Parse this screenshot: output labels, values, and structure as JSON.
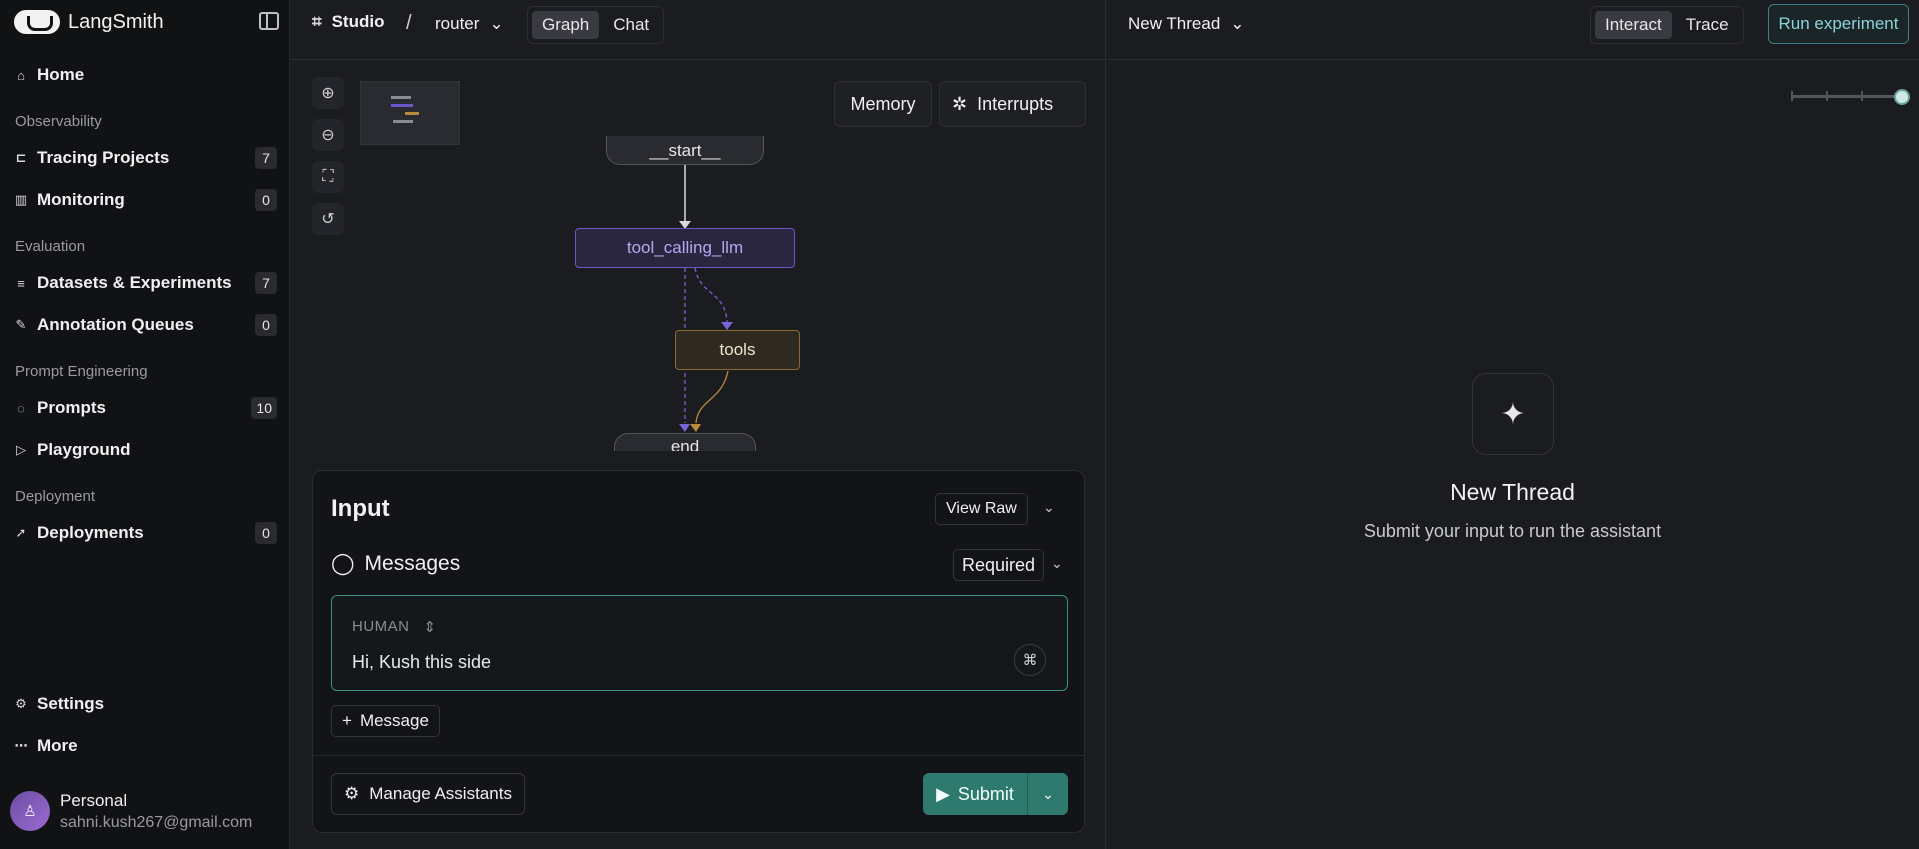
{
  "app": {
    "name": "LangSmith"
  },
  "sidebar": {
    "items": [
      {
        "label": "Home",
        "icon": "home-icon"
      },
      {
        "label": "Tracing Projects",
        "icon": "tracing-icon",
        "count": "7"
      },
      {
        "label": "Monitoring",
        "icon": "bar-chart-icon",
        "count": "0"
      },
      {
        "label": "Datasets & Experiments",
        "icon": "database-icon",
        "count": "7"
      },
      {
        "label": "Annotation Queues",
        "icon": "pen-icon",
        "count": "0"
      },
      {
        "label": "Prompts",
        "icon": "chat-icon",
        "count": "10"
      },
      {
        "label": "Playground",
        "icon": "play-icon"
      },
      {
        "label": "Deployments",
        "icon": "rocket-icon",
        "count": "0"
      },
      {
        "label": "Settings",
        "icon": "gear-icon"
      },
      {
        "label": "More",
        "icon": "more-icon"
      }
    ],
    "sections": [
      "Observability",
      "Evaluation",
      "Prompt Engineering",
      "Deployment"
    ],
    "account": {
      "name": "Personal",
      "email": "sahni.kush267@gmail.com"
    }
  },
  "topbar": {
    "studio": "Studio",
    "separator": "/",
    "graph_name": "router",
    "view_tabs": [
      "Graph",
      "Chat"
    ],
    "active_view": "Graph",
    "thread": "New Thread",
    "mode_tabs": [
      "Interact",
      "Trace"
    ],
    "active_mode": "Interact",
    "run_experiment": "Run experiment"
  },
  "graph": {
    "memory_label": "Memory",
    "interrupts_label": "Interrupts",
    "nodes": {
      "start": "__start__",
      "tool_calling_llm": "tool_calling_llm",
      "tools": "tools",
      "end": "__end__"
    },
    "colors": {
      "llm_node_border": "#6b58c9",
      "tools_node_border": "#8a6a2e",
      "edge_llm": "#7a62d8",
      "edge_tools": "#b98a3c"
    }
  },
  "input": {
    "title": "Input",
    "view_raw": "View Raw",
    "messages_label": "Messages",
    "required_label": "Required",
    "role": "HUMAN",
    "message_text": "Hi, Kush this side",
    "add_message": "Message",
    "manage_assistants": "Manage Assistants",
    "submit": "Submit"
  },
  "thread_panel": {
    "title": "New Thread",
    "subtitle": "Submit your input to run the assistant"
  }
}
